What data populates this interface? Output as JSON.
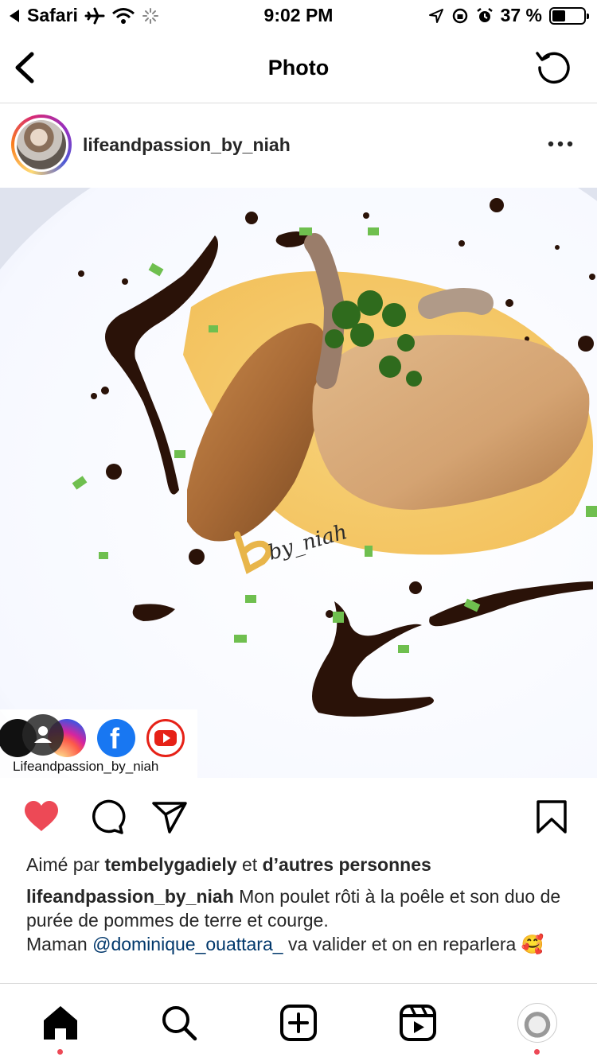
{
  "status_bar": {
    "back_app": "Safari",
    "time": "9:02 PM",
    "battery": "37 %",
    "battery_level": 0.37
  },
  "header": {
    "title": "Photo"
  },
  "post": {
    "username": "lifeandpassion_by_niah",
    "watermark": "by_niah",
    "social_label": "Lifeandpassion_by_niah",
    "liked": true,
    "likes": {
      "prefix": "Aimé par",
      "user": "tembelygadiely",
      "connector": "et",
      "others": "d’autres personnes"
    },
    "caption": {
      "author": "lifeandpassion_by_niah",
      "text": "Mon poulet rôti à la poêle et son duo de purée de pommes de terre et courge.",
      "line2_start": "Maman",
      "mention": "@dominique_ouattara_",
      "line2_end": "va valider et on en reparlera 🥰"
    }
  },
  "colors": {
    "like": "#ed4956",
    "text": "#262626",
    "mention": "#00376b",
    "divider": "#dbdbdb"
  },
  "icons": {
    "back": "chevron-left-icon",
    "refresh": "refresh-icon",
    "more": "more-horizontal-icon",
    "like": "heart-icon",
    "comment": "comment-icon",
    "share": "paper-plane-icon",
    "save": "bookmark-icon"
  }
}
